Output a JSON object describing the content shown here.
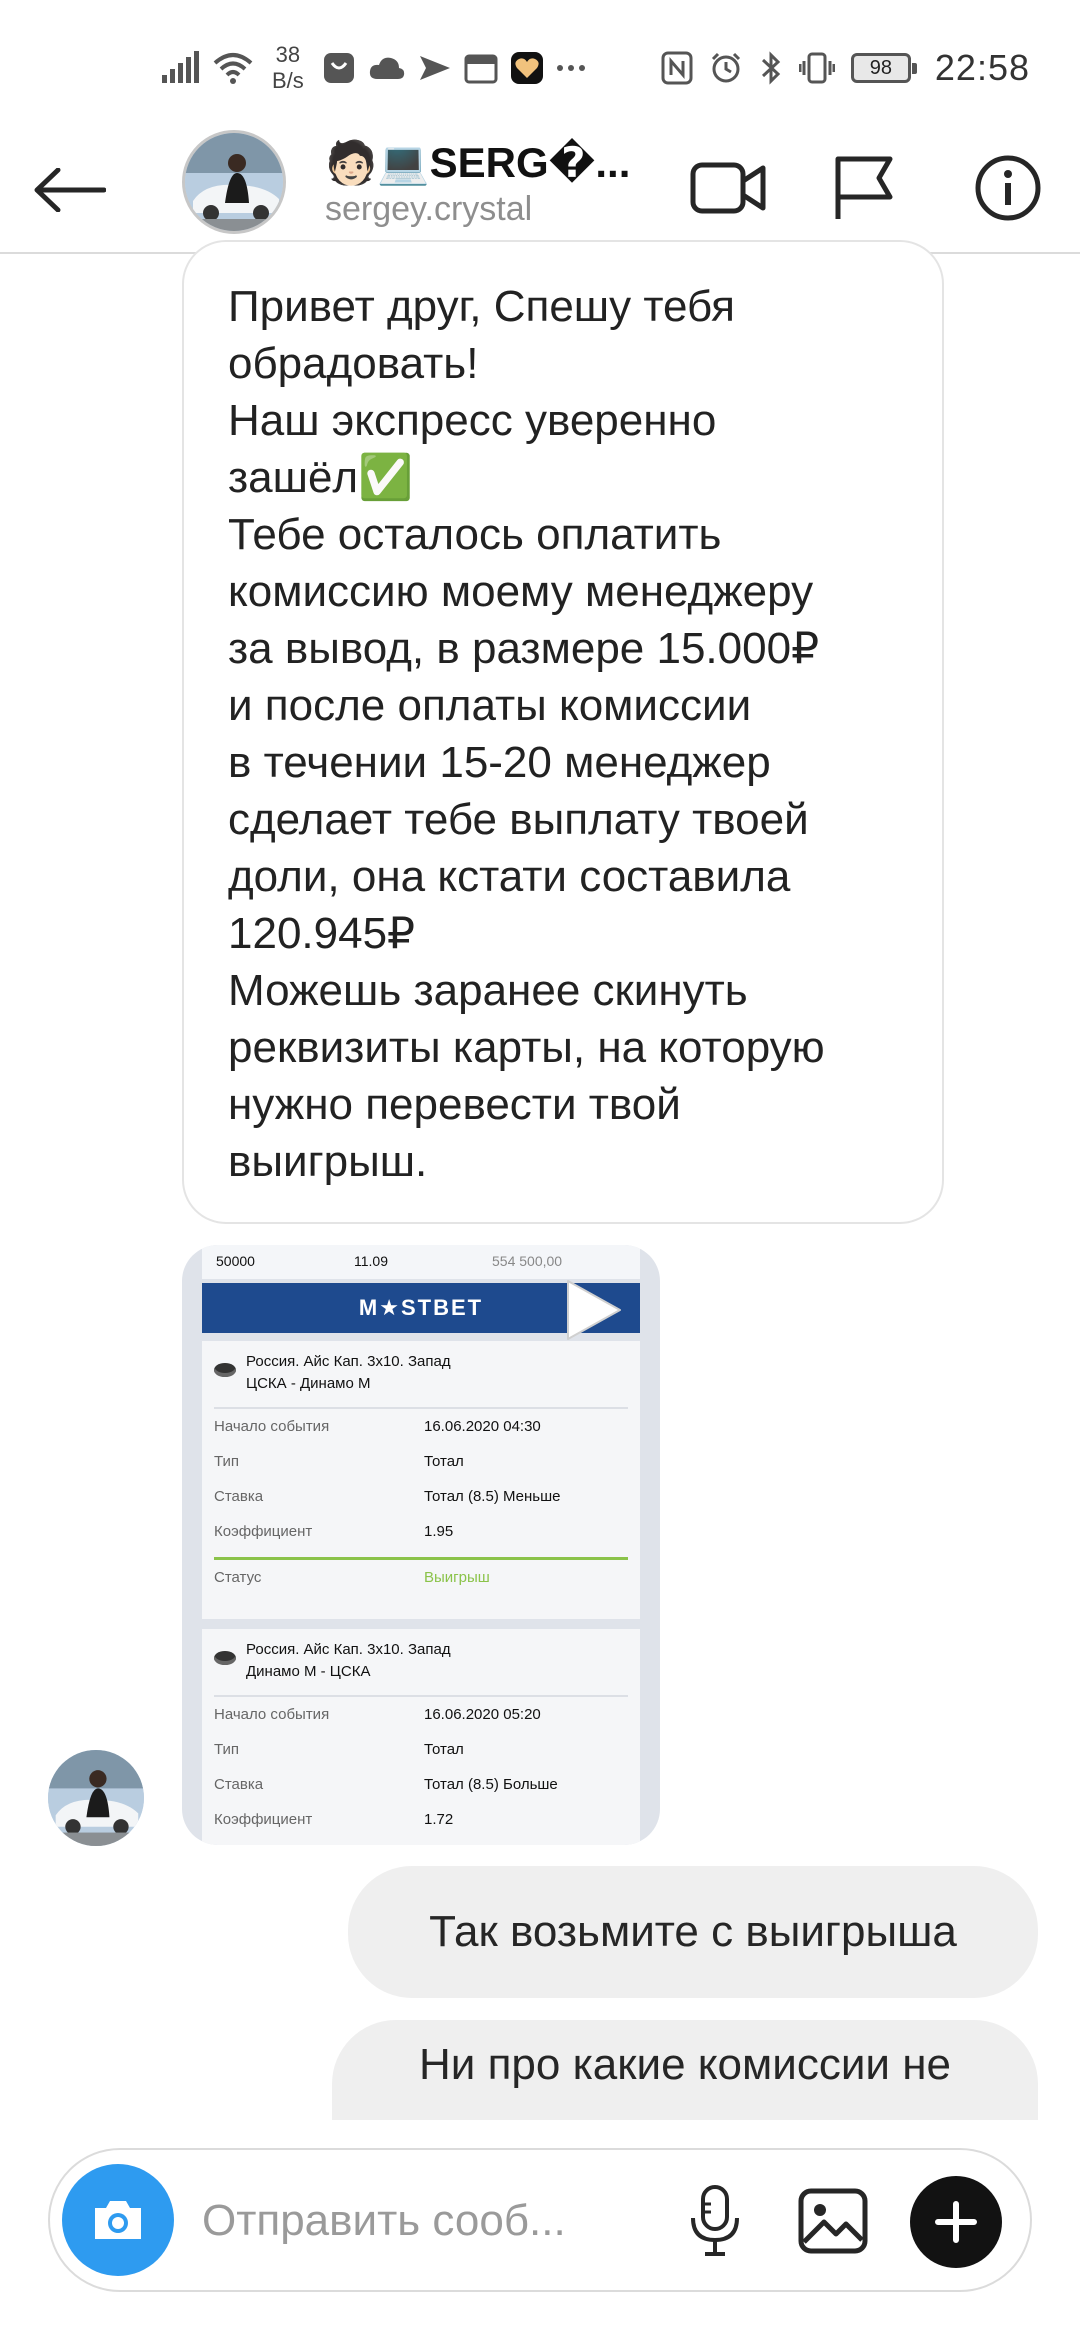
{
  "status_bar": {
    "net_speed_value": "38",
    "net_speed_unit": "B/s",
    "battery": "98",
    "time": "22:58"
  },
  "header": {
    "name": "🧑🏻💻SERG�...",
    "username": "sergey.crystal",
    "icons": [
      "back-arrow-icon",
      "video-call-icon",
      "flag-icon",
      "info-icon"
    ]
  },
  "messages": {
    "incoming_text": "Привет друг, Спешу тебя\nобрадовать!\nНаш экспресс уверенно\nзашёл✅\nТебе осталось оплатить\nкомиссию моему менеджеру\nза вывод, в размере 15.000₽\nи после оплаты комиссии\nв течении 15-20 менеджер\nсделает тебе выплату твоей\nдоли, она кстати составила\n120.945₽\nМожешь заранее скинуть\nреквизиты карты, на которую\nнужно перевести твой\nвыигрыш.",
    "outgoing_1": "Так возьмите с выигрыша",
    "outgoing_2": "Ни про какие комиссии не"
  },
  "ticket": {
    "top_row": [
      "50000",
      "11.09",
      "554 500,00"
    ],
    "brand": "M★STBET",
    "bets": [
      {
        "league": "Россия. Айс Кап. 3х10. Запад",
        "match": "ЦСКА - Динамо М",
        "rows": [
          {
            "k": "Начало события",
            "v": "16.06.2020 04:30"
          },
          {
            "k": "Тип",
            "v": "Тотал"
          },
          {
            "k": "Ставка",
            "v": "Тотал (8.5) Меньше"
          },
          {
            "k": "Коэффициент",
            "v": "1.95"
          }
        ],
        "status_label": "Статус",
        "status_value": "Выигрыш"
      },
      {
        "league": "Россия. Айс Кап. 3х10. Запад",
        "match": "Динамо М - ЦСКА",
        "rows": [
          {
            "k": "Начало события",
            "v": "16.06.2020 05:20"
          },
          {
            "k": "Тип",
            "v": "Тотал"
          },
          {
            "k": "Ставка",
            "v": "Тотал (8.5) Больше"
          },
          {
            "k": "Коэффициент",
            "v": "1.72"
          }
        ]
      }
    ]
  },
  "composer": {
    "placeholder": "Отправить сооб...",
    "icons": [
      "camera-icon",
      "microphone-icon",
      "gallery-icon",
      "plus-icon"
    ]
  },
  "colors": {
    "camera_button": "#2e9bf0",
    "bubble_outgoing": "#efefef",
    "ticket_banner": "#1e4a8e",
    "win_status": "#8bc34a"
  }
}
